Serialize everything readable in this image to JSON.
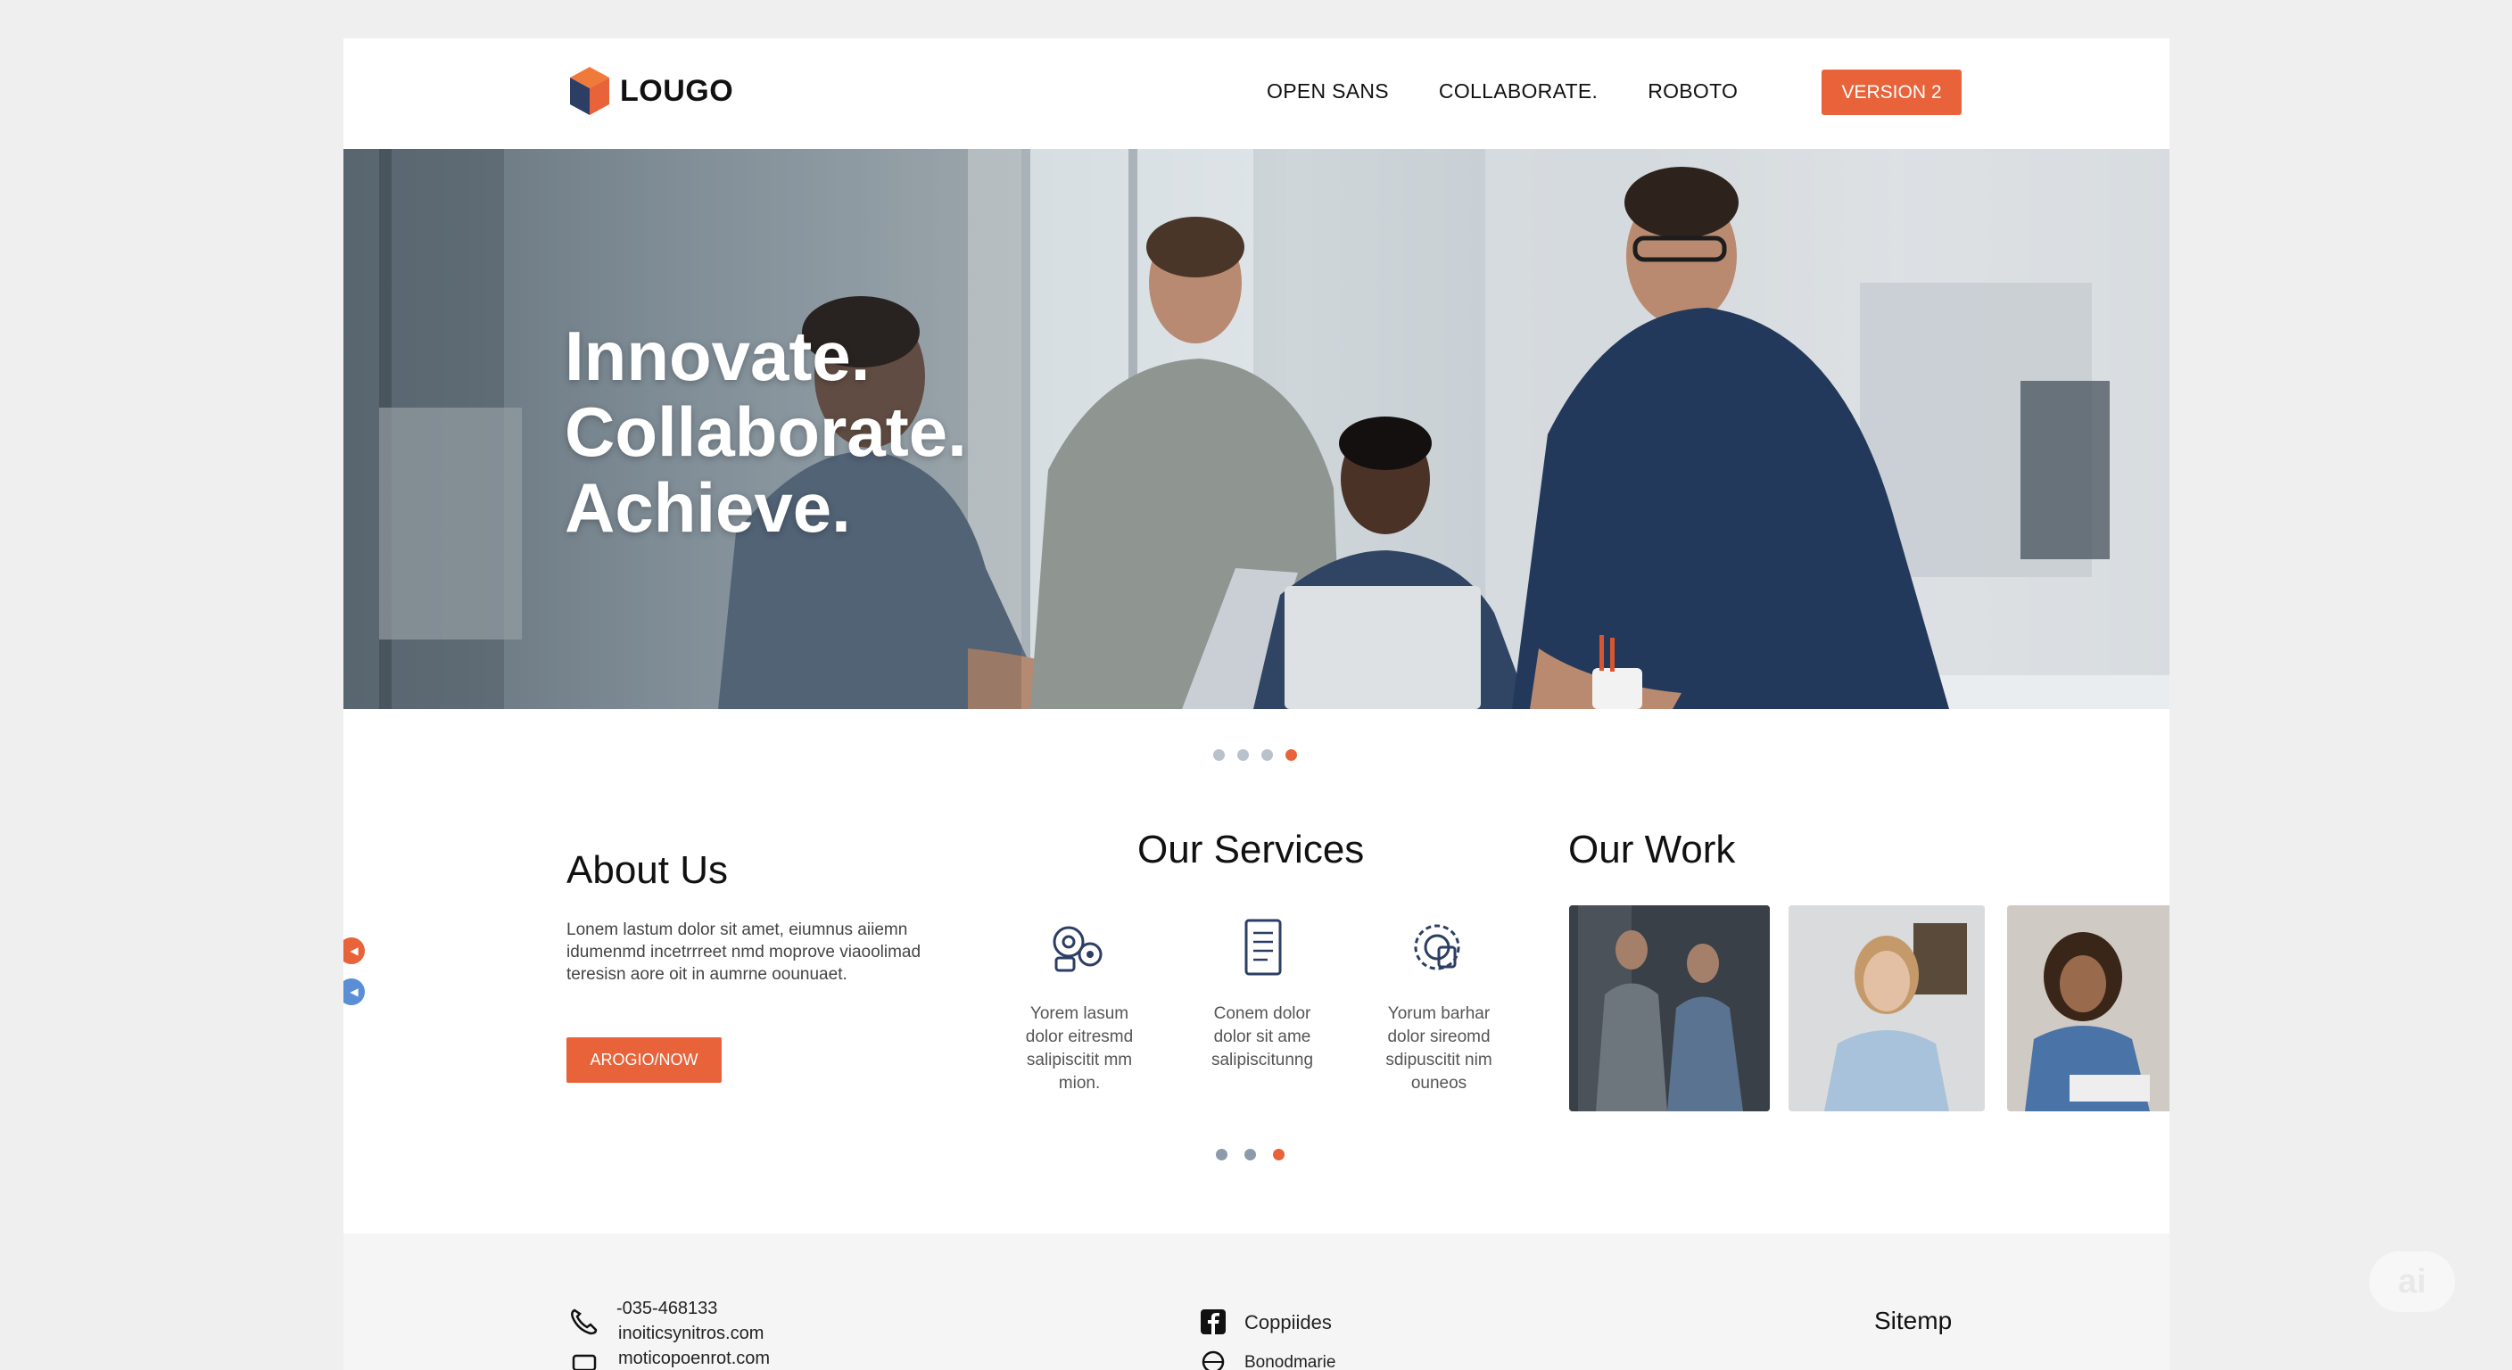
{
  "header": {
    "logo_text": "LOUGO",
    "nav": [
      "OPEN SANS",
      "COLLABORATE.",
      "ROBOTO"
    ],
    "cta_label": "VERSION 2"
  },
  "hero": {
    "lines": [
      "Innovate.",
      "Collaborate.",
      "Achieve."
    ],
    "carousel_active_index": 3,
    "carousel_count": 4
  },
  "about": {
    "title": "About Us",
    "text": "Lonem lastum dolor sit amet, eiumnus aiiemn idumenmd incetrrreet nmd moprove viaoolimad teresisn aore oit in aumrne oounuaet.",
    "button_label": "AROGIO/NOW"
  },
  "services": {
    "title": "Our Services",
    "items": [
      {
        "icon": "gears-icon",
        "line1": "Yorem lasum",
        "line2": "dolor eitresmd",
        "line3": "salipiscitit mm",
        "line4": "mion."
      },
      {
        "icon": "document-icon",
        "line1": "Conem dolor",
        "line2": "dolor sit ame",
        "line3": "salipiscitunng",
        "line4": ""
      },
      {
        "icon": "target-icon",
        "line1": "Yorum barhar",
        "line2": "dolor sireomd",
        "line3": "sdipuscitit nim",
        "line4": "ouneos"
      }
    ],
    "carousel_active_index": 2,
    "carousel_count": 3
  },
  "work": {
    "title": "Our Work"
  },
  "footer": {
    "phone": "-035-468133",
    "email1": "inoiticsynitros.com",
    "email2": "moticopoenrot.com",
    "social1": "Coppiides",
    "social2": "Bonodmarie",
    "sitemap": "Sitemp"
  },
  "colors": {
    "accent": "#e8633a",
    "arrow_blue": "#5a8fd6",
    "dot_inactive": "#b9c1cc"
  },
  "badge": "ai"
}
